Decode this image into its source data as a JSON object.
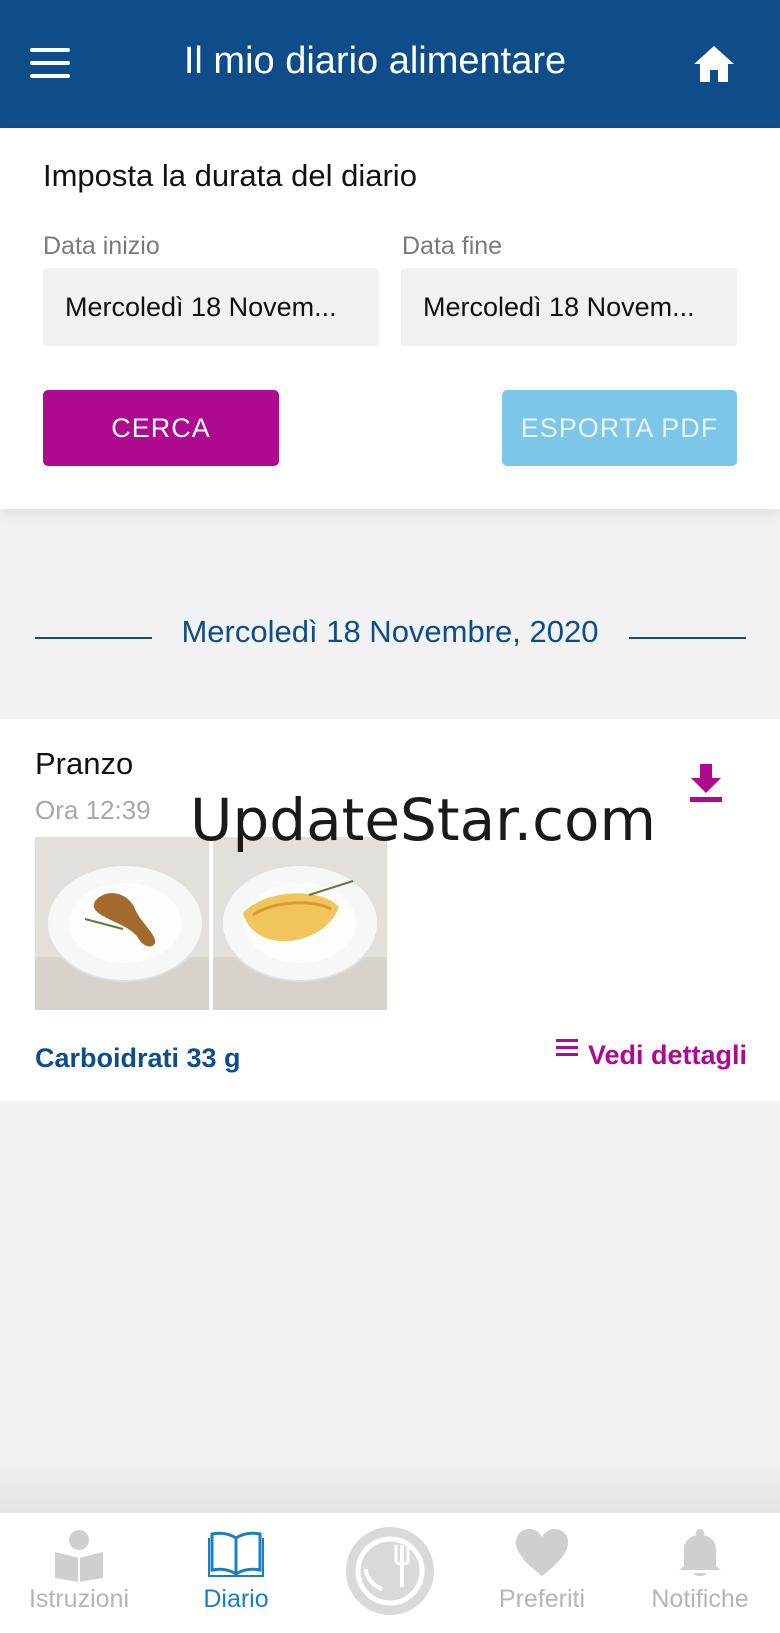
{
  "header": {
    "title": "Il mio diario alimentare"
  },
  "filter": {
    "title": "Imposta la durata del diario",
    "start_label": "Data inizio",
    "start_value": "Mercoledì 18 Novem...",
    "end_label": "Data fine",
    "end_value": "Mercoledì 18 Novem...",
    "search_button": "CERCA",
    "export_button": "ESPORTA PDF"
  },
  "day": {
    "date": "Mercoledì 18 Novembre, 2020"
  },
  "meal": {
    "name": "Pranzo",
    "time": "Ora 12:39",
    "carbs": "Carboidrati 33 g",
    "details_label": "Vedi dettagli",
    "images": [
      "chicken-leg-plate",
      "omelette-plate"
    ]
  },
  "watermark": "UpdateStar.com",
  "bottom_nav": {
    "items": [
      {
        "label": "Istruzioni",
        "icon": "book-person-icon",
        "active": false
      },
      {
        "label": "Diario",
        "icon": "open-book-icon",
        "active": true
      },
      {
        "label": "Preferiti",
        "icon": "heart-icon",
        "active": false
      },
      {
        "label": "Notifiche",
        "icon": "bell-icon",
        "active": false
      }
    ],
    "center_icon": "plate-fork-icon"
  },
  "colors": {
    "primary": "#0e4c8a",
    "accent": "#ad0a8f",
    "export": "#7cc6ea",
    "active_tab": "#1a7fc1"
  }
}
